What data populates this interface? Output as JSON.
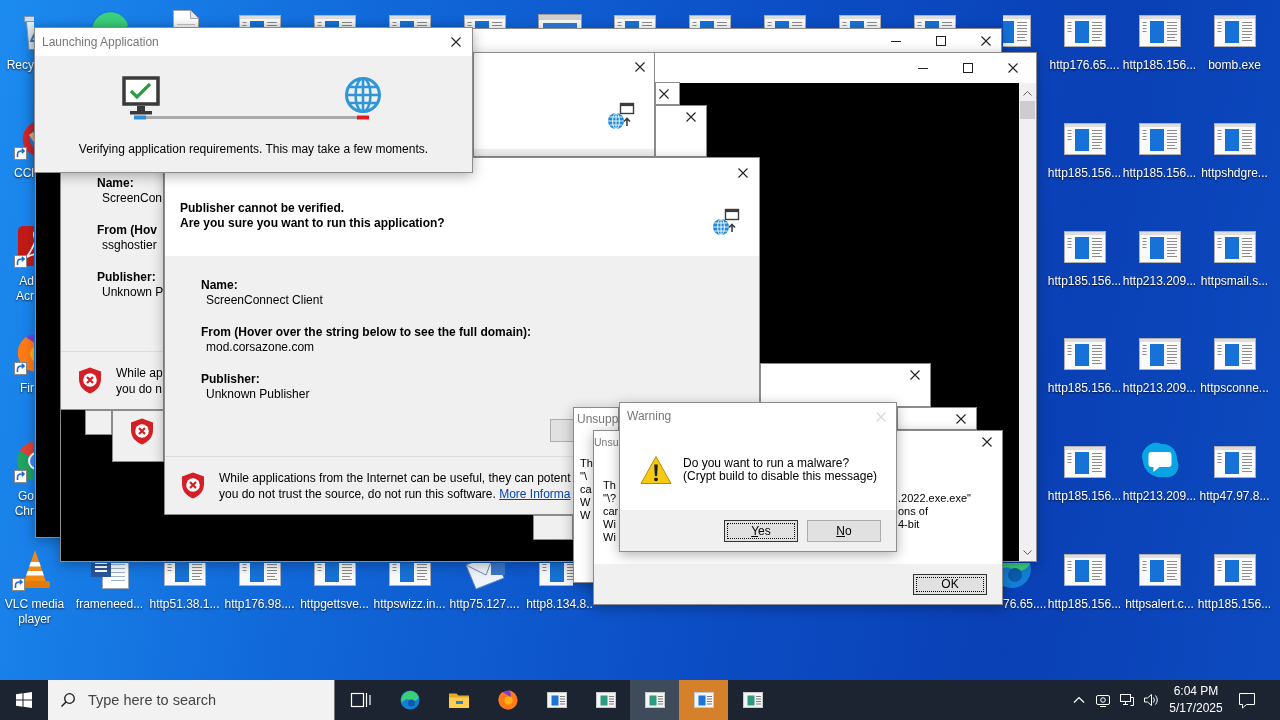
{
  "desktop": {
    "top_row": [
      {
        "kind": "edge"
      },
      {
        "kind": "document"
      },
      {
        "kind": "file"
      },
      {
        "kind": "file"
      },
      {
        "kind": "file"
      },
      {
        "kind": "file"
      },
      {
        "kind": "app"
      },
      {
        "kind": "file"
      },
      {
        "kind": "file"
      },
      {
        "kind": "file"
      },
      {
        "kind": "file"
      },
      {
        "kind": "file"
      },
      {
        "kind": "file"
      }
    ],
    "left_column": [
      {
        "label": "Recy",
        "kind": "recycle",
        "shortcut": false
      },
      {
        "label": "CCl",
        "kind": "ccleaner",
        "shortcut": true
      },
      {
        "label": "Ad Acr",
        "kind": "acrobat",
        "shortcut": true
      },
      {
        "label": "Fir",
        "kind": "firefox",
        "shortcut": true
      },
      {
        "label": "Go Chr",
        "kind": "chrome",
        "shortcut": true
      }
    ],
    "bottom_row": [
      {
        "label": "VLC media player",
        "kind": "vlc",
        "shortcut": true
      },
      {
        "label": "frameneed...",
        "kind": "word",
        "shortcut": false
      },
      {
        "label": "http51.38.1...",
        "kind": "file",
        "shortcut": false
      },
      {
        "label": "http176.98....",
        "kind": "file",
        "shortcut": false
      },
      {
        "label": "httpgettsve...",
        "kind": "file",
        "shortcut": false
      },
      {
        "label": "httpswizz.in...",
        "kind": "file",
        "shortcut": false
      },
      {
        "label": "http75.127....",
        "kind": "mail",
        "shortcut": false
      },
      {
        "label": "http8.134.8..",
        "kind": "file",
        "shortcut": false
      }
    ],
    "cut_icon": {
      "label": "76.65....",
      "kind": "edge"
    },
    "right_grid": [
      {
        "label": "http176.65....",
        "kind": "file"
      },
      {
        "label": "http185.156...",
        "kind": "file"
      },
      {
        "label": "bomb.exe",
        "kind": "file"
      },
      {
        "label": "http185.156...",
        "kind": "file"
      },
      {
        "label": "http185.156...",
        "kind": "file"
      },
      {
        "label": "httpshdgre...",
        "kind": "file"
      },
      {
        "label": "http185.156...",
        "kind": "file"
      },
      {
        "label": "http213.209...",
        "kind": "file"
      },
      {
        "label": "httpsmail.s...",
        "kind": "file"
      },
      {
        "label": "http185.156...",
        "kind": "file"
      },
      {
        "label": "http213.209...",
        "kind": "file"
      },
      {
        "label": "httpsconne...",
        "kind": "file"
      },
      {
        "label": "http185.156...",
        "kind": "file"
      },
      {
        "label": "http213.209...",
        "kind": "skype"
      },
      {
        "label": "http47.97.8...",
        "kind": "file"
      },
      {
        "label": "http185.156...",
        "kind": "file"
      },
      {
        "label": "httpsalert.c...",
        "kind": "file"
      },
      {
        "label": "http185.156...",
        "kind": "file"
      }
    ]
  },
  "console_windows": [
    {
      "kind": "plain"
    },
    {
      "kind": "scrolling"
    }
  ],
  "dialog_edges": [
    {
      "kind": "security_header"
    },
    {
      "kind": "close"
    },
    {
      "kind": "close"
    },
    {
      "kind": "blank"
    },
    {
      "kind": "shield"
    },
    {
      "kind": "blank"
    },
    {
      "kind": "close"
    },
    {
      "kind": "close"
    }
  ],
  "security_dialog_behind": {
    "fields": [
      {
        "label": "Name:",
        "value": "ScreenCon"
      },
      {
        "label": "From (Hov",
        "value": "ssghostier"
      },
      {
        "label": "Publisher:",
        "value": "Unknown P"
      }
    ],
    "footer": {
      "lines": [
        "While ap",
        "you do n"
      ]
    }
  },
  "security_dialog": {
    "heading": [
      "Publisher cannot be verified.",
      "Are you sure you want to run this application?"
    ],
    "fields": [
      {
        "label": "Name:",
        "value": "ScreenConnect Client"
      },
      {
        "label": "From (Hover over the string below to see the full domain):",
        "value": "mod.corsazone.com"
      },
      {
        "label": "Publisher:",
        "value": "Unknown Publisher"
      }
    ],
    "footer": {
      "lines": [
        "While applications from the Internet can be useful, they can potent",
        "you do not trust the source, do not run this software. "
      ],
      "link": "More Informa"
    }
  },
  "unsupported_dialogs": [
    {
      "title": "Unsupp",
      "rows": [
        {
          "start": "Th"
        },
        {
          "start": "\"\\"
        },
        {
          "start": "ca"
        },
        {
          "start": "W"
        },
        {
          "start": "W"
        }
      ]
    },
    {
      "title": "Unsu",
      "rows": [
        {
          "start": "Th"
        },
        {
          "start": "\"\\?",
          "end": ".2022.exe.exe\""
        },
        {
          "start": "car",
          "end": "ons of"
        },
        {
          "start": "Wi",
          "end": "4-bit"
        },
        {
          "start": "Wi"
        }
      ],
      "button": {
        "label": "OK",
        "focused": true
      }
    }
  ],
  "warning_dialog": {
    "title": "Warning",
    "close_disabled": true,
    "message": [
      "Do you want to run a malware?",
      "(Crypt build to disable this message)"
    ],
    "buttons": [
      {
        "label": "Yes",
        "mnemonic": true,
        "focused": true
      },
      {
        "label": "No",
        "mnemonic": true,
        "focused": false
      }
    ]
  },
  "launching_dialog": {
    "title": "Launching Application",
    "message": "Verifying application requirements. This may take a few moments."
  },
  "taskbar": {
    "search": {
      "placeholder": "Type here to search"
    },
    "items": [
      {
        "kind": "task_view",
        "active": false,
        "flashing": false
      },
      {
        "kind": "edge",
        "active": false,
        "flashing": false
      },
      {
        "kind": "explorer",
        "active": false,
        "flashing": false
      },
      {
        "kind": "firefox",
        "active": false,
        "flashing": false
      },
      {
        "kind": "app",
        "active": false,
        "flashing": false
      },
      {
        "kind": "app_green",
        "active": false,
        "flashing": false
      },
      {
        "kind": "app_green",
        "active": true,
        "flashing": false
      },
      {
        "kind": "app",
        "active": false,
        "flashing": true
      },
      {
        "kind": "app_green",
        "active": false,
        "flashing": false
      }
    ],
    "tray": {
      "icons": [
        {
          "kind": "chevron"
        },
        {
          "kind": "camera"
        },
        {
          "kind": "network"
        },
        {
          "kind": "volume"
        }
      ],
      "time": "6:04 PM",
      "date": "5/17/2025"
    }
  }
}
